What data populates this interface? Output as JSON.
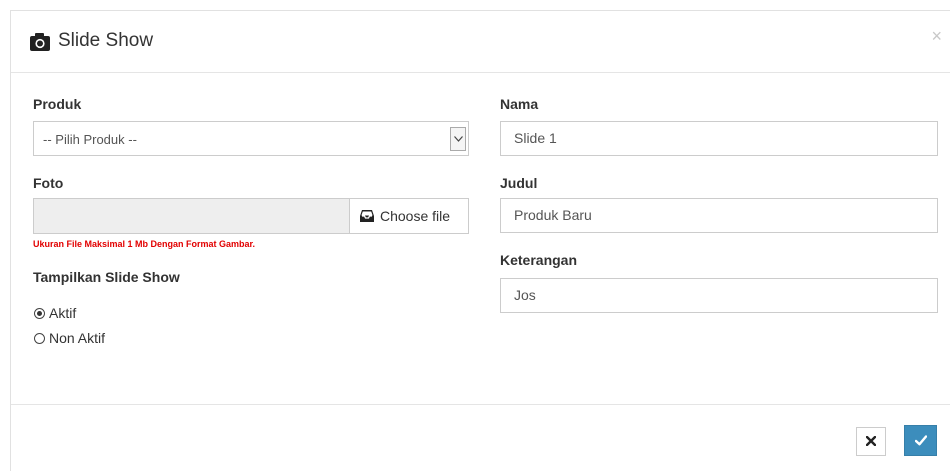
{
  "modal": {
    "title": "Slide Show",
    "title_icon": "camera-icon",
    "close_label": "×"
  },
  "left": {
    "produk_label": "Produk",
    "produk_select": {
      "selected": "-- Pilih Produk --"
    },
    "foto_label": "Foto",
    "choose_file_label": "Choose file",
    "file_hint": "Ukuran File Maksimal 1 Mb Dengan Format Gambar.",
    "tampilkan_label": "Tampilkan Slide Show",
    "radios": [
      {
        "label": "Aktif",
        "checked": true
      },
      {
        "label": "Non Aktif",
        "checked": false
      }
    ]
  },
  "right": {
    "nama_label": "Nama",
    "nama_value": "Slide 1",
    "judul_label": "Judul",
    "judul_value": "Produk Baru",
    "keterangan_label": "Keterangan",
    "keterangan_value": "Jos"
  },
  "footer": {
    "cancel_icon": "times-icon",
    "save_icon": "check-icon"
  },
  "colors": {
    "primary": "#3c8dbc",
    "hint": "#e20000",
    "border": "#cccccc"
  }
}
